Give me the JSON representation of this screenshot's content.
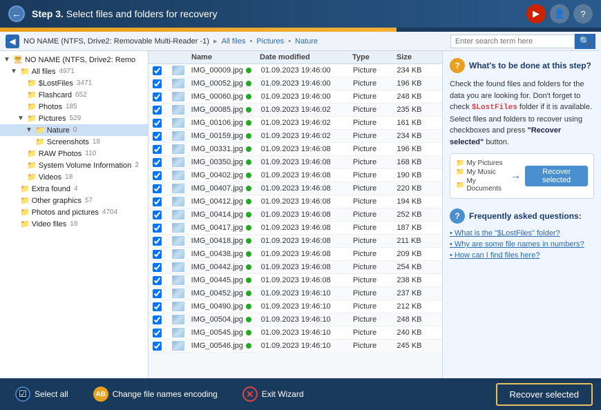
{
  "titleBar": {
    "step": "Step 3.",
    "title": "Select files and folders for recovery",
    "backBtn": "←",
    "youtubeIcon": "▶",
    "userIcon": "👤",
    "helpIcon": "?"
  },
  "breadcrumb": {
    "navIcon": "◀",
    "path": "NO NAME (NTFS, Drive2: Removable Multi-Reader -1)",
    "sep1": "▸",
    "link1": "All files",
    "sep2": "•",
    "link2": "Pictures",
    "sep3": "•",
    "link3": "Nature",
    "searchPlaceholder": "Enter search term here"
  },
  "treeItems": [
    {
      "indent": 0,
      "expand": "▼",
      "icon": "🖥",
      "label": "NO NAME (NTFS, Drive2: Remo",
      "count": "",
      "selected": false
    },
    {
      "indent": 1,
      "expand": "▼",
      "icon": "📁",
      "label": "All files",
      "count": "4971",
      "selected": false
    },
    {
      "indent": 2,
      "expand": " ",
      "icon": "📁",
      "label": "$LostFiles",
      "count": "3471",
      "selected": false
    },
    {
      "indent": 2,
      "expand": " ",
      "icon": "📁",
      "label": "Flashcard",
      "count": "652",
      "selected": false
    },
    {
      "indent": 2,
      "expand": " ",
      "icon": "📁",
      "label": "Photos",
      "count": "185",
      "selected": false
    },
    {
      "indent": 2,
      "expand": "▼",
      "icon": "📁",
      "label": "Pictures",
      "count": "529",
      "selected": false
    },
    {
      "indent": 3,
      "expand": "▼",
      "icon": "📁",
      "label": "Nature",
      "count": "0",
      "selected": true
    },
    {
      "indent": 3,
      "expand": " ",
      "icon": "📁",
      "label": "Screenshots",
      "count": "18",
      "selected": false
    },
    {
      "indent": 2,
      "expand": " ",
      "icon": "📁",
      "label": "RAW Photos",
      "count": "110",
      "selected": false
    },
    {
      "indent": 2,
      "expand": " ",
      "icon": "📁",
      "label": "System Volume Information",
      "count": "2",
      "selected": false
    },
    {
      "indent": 2,
      "expand": " ",
      "icon": "📁",
      "label": "Videos",
      "count": "18",
      "selected": false
    },
    {
      "indent": 1,
      "expand": " ",
      "icon": "📁",
      "label": "Extra found",
      "count": "4",
      "selected": false
    },
    {
      "indent": 1,
      "expand": " ",
      "icon": "📁",
      "label": "Other graphics",
      "count": "57",
      "selected": false
    },
    {
      "indent": 1,
      "expand": " ",
      "icon": "📁",
      "label": "Photos and pictures",
      "count": "4704",
      "selected": false
    },
    {
      "indent": 1,
      "expand": " ",
      "icon": "📁",
      "label": "Video files",
      "count": "18",
      "selected": false
    }
  ],
  "fileList": {
    "columns": [
      "",
      "",
      "Name",
      "",
      "Date modified",
      "Type",
      "Size"
    ],
    "files": [
      {
        "name": "IMG_00009.jpg",
        "date": "01.09.2023 19:46:00",
        "type": "Picture",
        "size": "234 KB"
      },
      {
        "name": "IMG_00052.jpg",
        "date": "01.09.2023 19:46:00",
        "type": "Picture",
        "size": "196 KB"
      },
      {
        "name": "IMG_00060.jpg",
        "date": "01.09.2023 19:46:00",
        "type": "Picture",
        "size": "248 KB"
      },
      {
        "name": "IMG_00085.jpg",
        "date": "01.09.2023 19:46:02",
        "type": "Picture",
        "size": "235 KB"
      },
      {
        "name": "IMG_00106.jpg",
        "date": "01.09.2023 19:46:02",
        "type": "Picture",
        "size": "161 KB"
      },
      {
        "name": "IMG_00159.jpg",
        "date": "01.09.2023 19:46:02",
        "type": "Picture",
        "size": "234 KB"
      },
      {
        "name": "IMG_00331.jpg",
        "date": "01.09.2023 19:46:08",
        "type": "Picture",
        "size": "196 KB"
      },
      {
        "name": "IMG_00350.jpg",
        "date": "01.09.2023 19:46:08",
        "type": "Picture",
        "size": "168 KB"
      },
      {
        "name": "IMG_00402.jpg",
        "date": "01.09.2023 19:46:08",
        "type": "Picture",
        "size": "190 KB"
      },
      {
        "name": "IMG_00407.jpg",
        "date": "01.09.2023 19:46:08",
        "type": "Picture",
        "size": "220 KB"
      },
      {
        "name": "IMG_00412.jpg",
        "date": "01.09.2023 19:46:08",
        "type": "Picture",
        "size": "194 KB"
      },
      {
        "name": "IMG_00414.jpg",
        "date": "01.09.2023 19:46:08",
        "type": "Picture",
        "size": "252 KB"
      },
      {
        "name": "IMG_00417.jpg",
        "date": "01.09.2023 19:46:08",
        "type": "Picture",
        "size": "187 KB"
      },
      {
        "name": "IMG_00418.jpg",
        "date": "01.09.2023 19:46:08",
        "type": "Picture",
        "size": "211 KB"
      },
      {
        "name": "IMG_00438.jpg",
        "date": "01.09.2023 19:46:08",
        "type": "Picture",
        "size": "209 KB"
      },
      {
        "name": "IMG_00442.jpg",
        "date": "01.09.2023 19:46:08",
        "type": "Picture",
        "size": "254 KB"
      },
      {
        "name": "IMG_00445.jpg",
        "date": "01.09.2023 19:46:08",
        "type": "Picture",
        "size": "238 KB"
      },
      {
        "name": "IMG_00452.jpg",
        "date": "01.09.2023 19:46:10",
        "type": "Picture",
        "size": "237 KB"
      },
      {
        "name": "IMG_00490.jpg",
        "date": "01.09.2023 19:46:10",
        "type": "Picture",
        "size": "212 KB"
      },
      {
        "name": "IMG_00504.jpg",
        "date": "01.09.2023 19:46:10",
        "type": "Picture",
        "size": "248 KB"
      },
      {
        "name": "IMG_00545.jpg",
        "date": "01.09.2023 19:46:10",
        "type": "Picture",
        "size": "240 KB"
      },
      {
        "name": "IMG_00546.jpg",
        "date": "01.09.2023 19:46:10",
        "type": "Picture",
        "size": "245 KB"
      }
    ]
  },
  "rightPanel": {
    "helpTitle": "What's to be done at this step?",
    "helpText": "Check the found files and folders for the data you are looking for. Don't forget to check",
    "helpCode": "$LostFiles",
    "helpText2": "folder if it is available. Select files and folders to recover using checkboxes and press",
    "helpQuoted": "\"Recover selected\"",
    "helpText3": "button.",
    "demoFolders": [
      "My Pictures",
      "My Music",
      "My Documents"
    ],
    "demoBtn": "Recover selected",
    "faqTitle": "Frequently asked questions:",
    "faqItems": [
      "What is the \"$LostFiles\" folder?",
      "Why are some file names in numbers?",
      "How can I find files here?"
    ]
  },
  "bottomBar": {
    "selectAll": "Select all",
    "changeEncoding": "Change file names encoding",
    "exitWizard": "Exit Wizard",
    "recoverSelected": "Recover selected"
  }
}
